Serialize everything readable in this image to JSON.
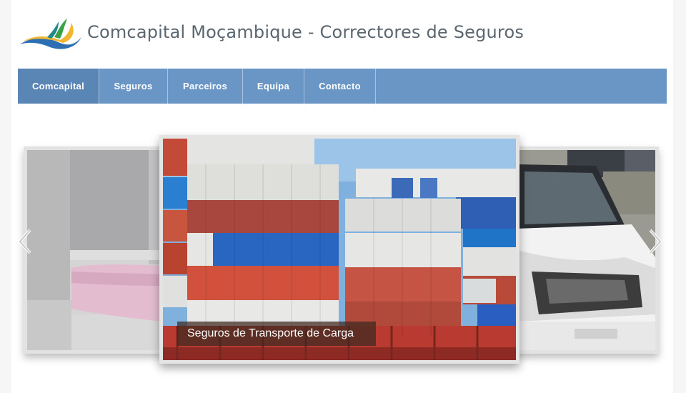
{
  "header": {
    "title": "Comcapital Moçambique - Correctores de Seguros"
  },
  "nav": {
    "items": [
      {
        "label": "Comcapital",
        "active": true
      },
      {
        "label": "Seguros",
        "active": false
      },
      {
        "label": "Parceiros",
        "active": false
      },
      {
        "label": "Equipa",
        "active": false
      },
      {
        "label": "Contacto",
        "active": false
      }
    ]
  },
  "slider": {
    "current_caption": "Seguros de Transporte de Carga",
    "prev_icon": "chevron-left-icon",
    "next_icon": "chevron-right-icon"
  },
  "colors": {
    "nav_bg": "#6a96c6",
    "nav_active": "#5a86b6",
    "title_text": "#5a6670"
  }
}
